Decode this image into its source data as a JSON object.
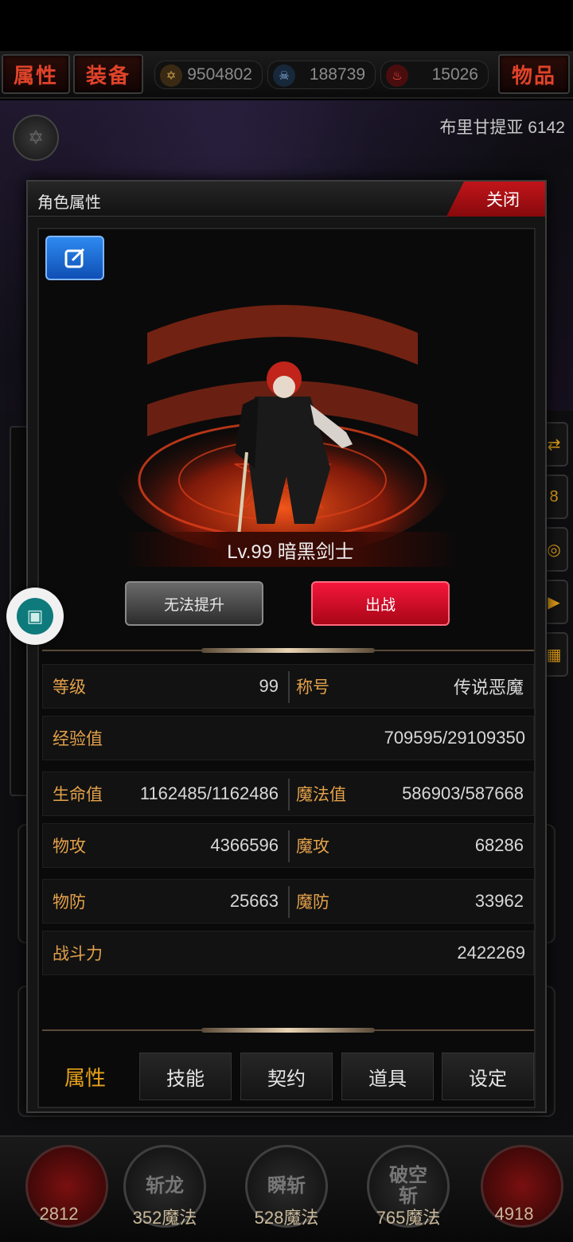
{
  "top_bar": {
    "attr_btn": "属性",
    "equip_btn": "装备",
    "items_btn": "物品",
    "resources": [
      {
        "icon": "star-coin-icon",
        "value": "9504802"
      },
      {
        "icon": "skull-gem-icon",
        "value": "188739"
      },
      {
        "icon": "red-crystal-icon",
        "value": "15026"
      }
    ]
  },
  "map": {
    "name": "布里甘提亚 6142"
  },
  "dialog": {
    "title": "角色属性",
    "close_label": "关闭",
    "hero": {
      "name_line": "Lv.99 暗黑剑士"
    },
    "upgrade_label": "无法提升",
    "fight_label": "出战",
    "stats": {
      "level_label": "等级",
      "level_value": "99",
      "title_label": "称号",
      "title_value": "传说恶魔",
      "exp_label": "经验值",
      "exp_value": "709595/29109350",
      "hp_label": "生命值",
      "hp_value": "1162485/1162486",
      "mp_label": "魔法值",
      "mp_value": "586903/587668",
      "patk_label": "物攻",
      "patk_value": "4366596",
      "matk_label": "魔攻",
      "matk_value": "68286",
      "pdef_label": "物防",
      "pdef_value": "25663",
      "mdef_label": "魔防",
      "mdef_value": "33962",
      "power_label": "战斗力",
      "power_value": "2422269"
    },
    "tabs": [
      {
        "label": "属性",
        "active": true
      },
      {
        "label": "技能",
        "active": false
      },
      {
        "label": "契约",
        "active": false
      },
      {
        "label": "道具",
        "active": false
      },
      {
        "label": "设定",
        "active": false
      }
    ]
  },
  "skills": [
    {
      "name": "",
      "sub": "2812"
    },
    {
      "name": "斩龙",
      "sub": "352魔法"
    },
    {
      "name": "瞬斩",
      "sub": "528魔法"
    },
    {
      "name": "破空斩",
      "sub": "765魔法"
    },
    {
      "name": "",
      "sub": "4918"
    }
  ],
  "colors": {
    "accent_gold": "#e3a14a",
    "close_red": "#c2151a",
    "fight_red": "#f5163c",
    "edit_blue": "#2e8af0"
  }
}
